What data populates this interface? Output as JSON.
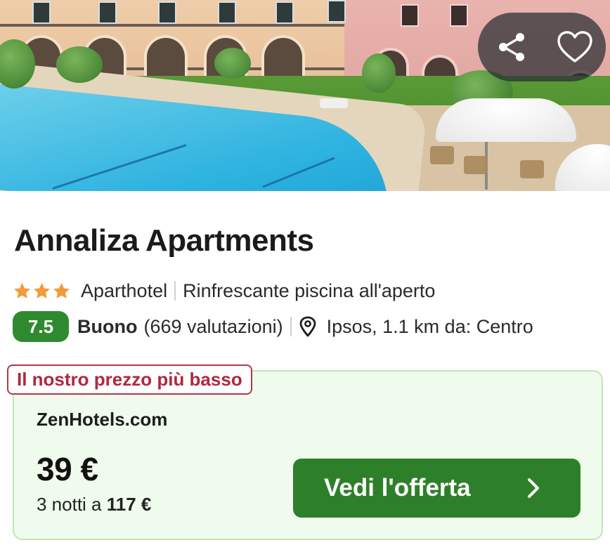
{
  "hotel": {
    "name": "Annaliza Apartments",
    "stars": 3,
    "type": "Aparthotel",
    "highlight": "Rinfrescante piscina all'aperto",
    "rating_score": "7.5",
    "rating_word": "Buono",
    "rating_count": "(669 valutazioni)",
    "location": "Ipsos, 1.1 km da: Centro"
  },
  "actions": {
    "share_icon": "share-icon",
    "favorite_icon": "heart-icon"
  },
  "offer": {
    "badge": "Il nostro prezzo più basso",
    "provider": "ZenHotels.com",
    "price": "39 €",
    "nights_label": "3 notti a",
    "total": "117 €",
    "cta_label": "Vedi l'offerta",
    "cta_icon": "chevron-right-icon"
  },
  "colors": {
    "star": "#f29b38",
    "score_bg": "#2f8a2f",
    "cta_bg": "#2e7f29",
    "badge": "#b0283f",
    "offer_bg": "#effbec"
  }
}
